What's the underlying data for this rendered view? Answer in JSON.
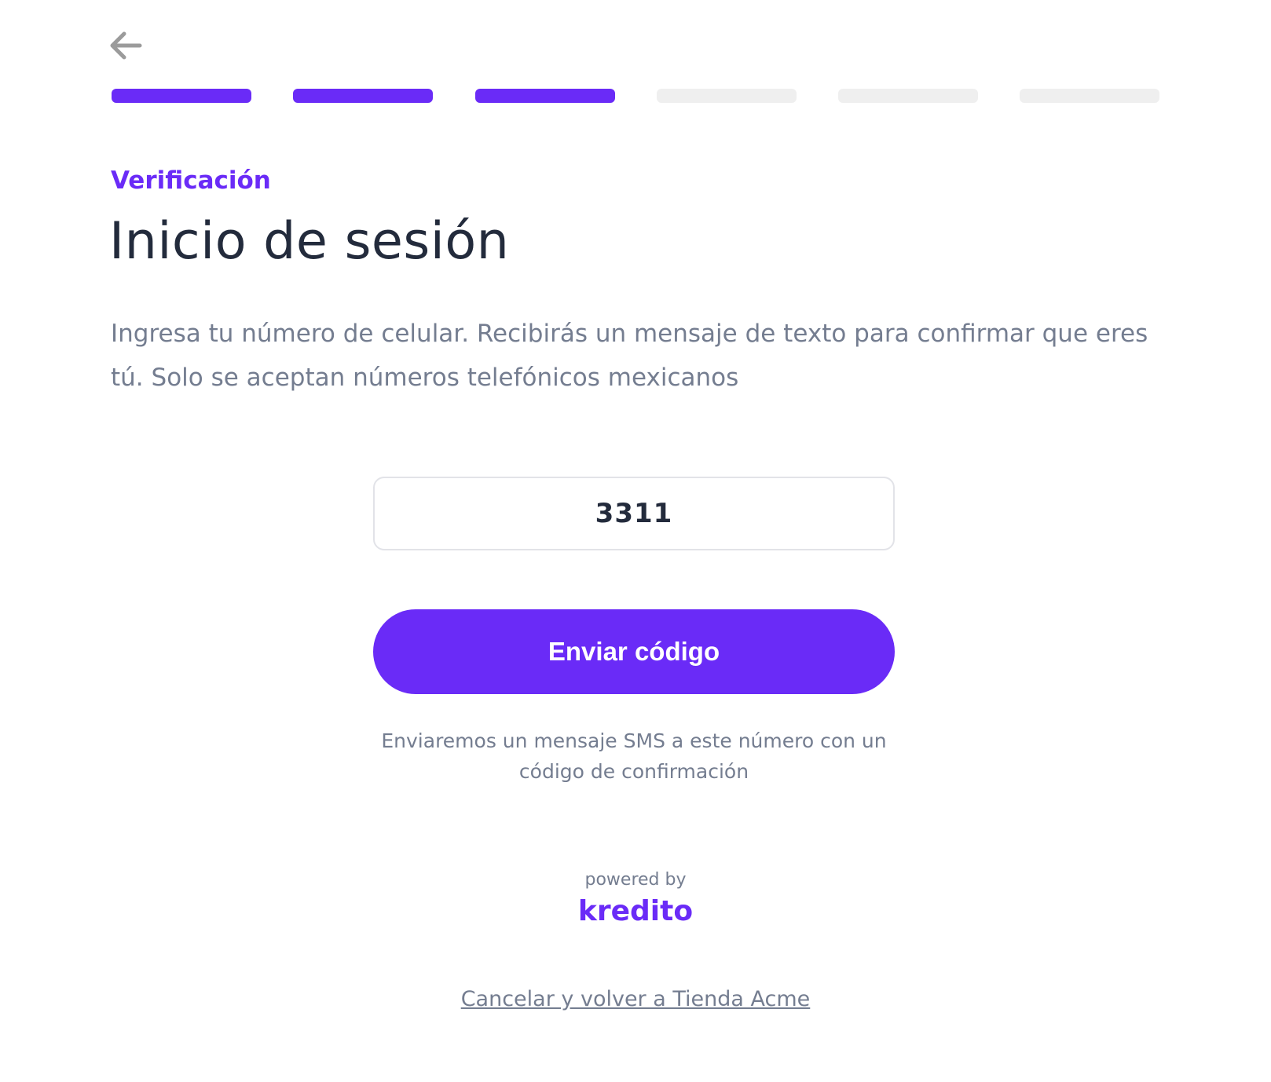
{
  "header": {
    "back_icon": "arrow-left-icon",
    "progress": {
      "total_steps": 6,
      "completed_steps": 3,
      "active_color": "#6a2bf7",
      "inactive_color": "#efefef"
    }
  },
  "main": {
    "eyebrow": "Verificación",
    "title": "Inicio de sesión",
    "instructions": "Ingresa tu número de celular. Recibirás un mensaje de texto para confirmar que eres tú. Solo se aceptan números telefónicos mexicanos",
    "phone_input": {
      "value": "3311"
    },
    "send_button_label": "Enviar código",
    "sms_note": "Enviaremos un mensaje SMS a este número con un código de confirmación"
  },
  "footer": {
    "powered_by": "powered by",
    "brand": "kredito",
    "cancel_link": "Cancelar y volver a Tienda Acme"
  },
  "colors": {
    "accent": "#6a2bf7",
    "heading": "#232b3c",
    "muted_text": "#747d90"
  }
}
